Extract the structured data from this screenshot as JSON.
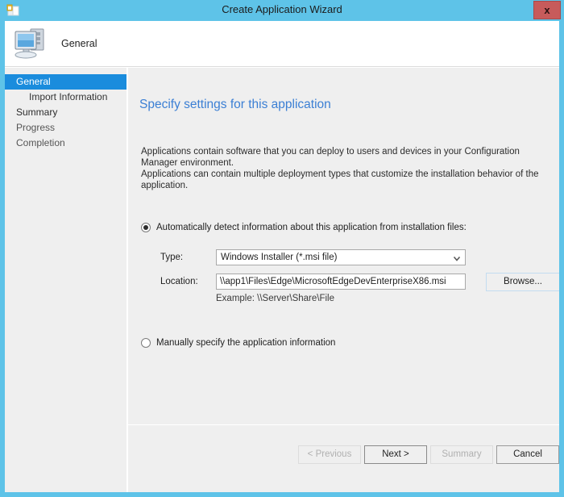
{
  "window": {
    "title": "Create Application Wizard",
    "title_icon": "application-wizard-icon",
    "close_label": "x",
    "accent_color": "#5ec3e8",
    "close_color": "#c75b5b"
  },
  "header": {
    "icon": "computer-icon",
    "label": "General"
  },
  "nav": {
    "items": [
      {
        "label": "General",
        "selected": true,
        "child": false
      },
      {
        "label": "Import Information",
        "selected": false,
        "child": true
      },
      {
        "label": "Summary",
        "selected": false,
        "child": false
      },
      {
        "label": "Progress",
        "selected": false,
        "child": false
      },
      {
        "label": "Completion",
        "selected": false,
        "child": false
      }
    ]
  },
  "content": {
    "page_title": "Specify settings for this application",
    "page_title_color": "#3b7fd4",
    "intro_line1": "Applications contain software that you can deploy to users and devices in your Configuration Manager environment.",
    "intro_line2": "Applications can contain multiple deployment types that customize the installation behavior of the application.",
    "option_auto": {
      "label": "Automatically detect information about this application from installation files:",
      "selected": true,
      "type_label": "Type:",
      "type_value": "Windows Installer (*.msi file)",
      "location_label": "Location:",
      "location_value": "\\\\app1\\Files\\Edge\\MicrosoftEdgeDevEnterpriseX86.msi",
      "browse_label": "Browse...",
      "example_text": "Example: \\\\Server\\Share\\File"
    },
    "option_manual": {
      "label": "Manually specify the application information",
      "selected": false
    }
  },
  "footer": {
    "buttons": [
      {
        "label": "< Previous",
        "state": "disabled"
      },
      {
        "label": "Next >",
        "state": "default"
      },
      {
        "label": "Summary",
        "state": "disabled"
      },
      {
        "label": "Cancel",
        "state": "enabled"
      }
    ]
  }
}
